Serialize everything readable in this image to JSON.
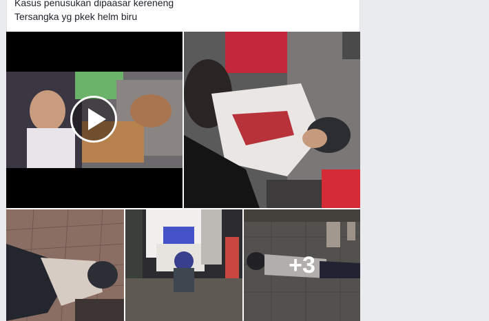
{
  "post": {
    "lines": [
      "Kasus penusukan dipaasar kereneng",
      "Tersangka yg pkek helm biru"
    ]
  },
  "media": {
    "more_count_label": "+3"
  }
}
